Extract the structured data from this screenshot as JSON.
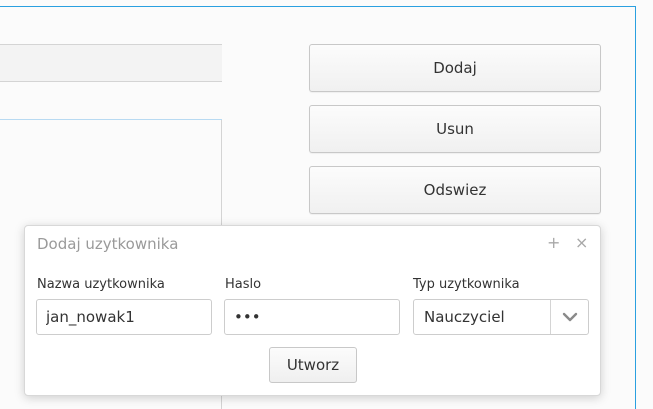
{
  "side_buttons": {
    "add_label": "Dodaj",
    "remove_label": "Usun",
    "refresh_label": "Odswiez"
  },
  "dialog": {
    "title": "Dodaj uzytkownika",
    "maximize_icon": "+",
    "close_icon": "×",
    "username": {
      "label": "Nazwa uzytkownika",
      "value": "jan_nowak1"
    },
    "password": {
      "label": "Haslo",
      "value": "•••"
    },
    "user_type": {
      "label": "Typ uzytkownika",
      "selected": "Nauczyciel"
    },
    "create_label": "Utworz"
  },
  "colors": {
    "accent": "#2aa0e0",
    "row_separator": "#b8daf2"
  }
}
